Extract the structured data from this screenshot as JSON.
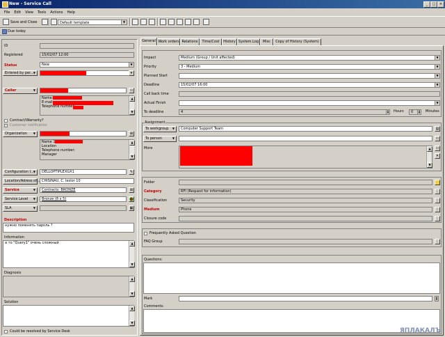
{
  "window": {
    "title": "New - Service Call"
  },
  "menu": [
    "File",
    "Edit",
    "View",
    "Tools",
    "Actions",
    "Help"
  ],
  "toolbar": {
    "save_close": "Save and Close",
    "template": "Default template"
  },
  "due_today": "Due today",
  "left": {
    "id_label": "ID",
    "registered_label": "Registered",
    "registered_value": "15/02/07 12:00",
    "status_label": "Status",
    "status_value": "New",
    "entered_by_label": "Entered by per...",
    "caller_label": "Caller",
    "caller_details": [
      "Name:",
      "E-mail:",
      "Telephone number:"
    ],
    "contract_warranty": "Contract/Warranty?",
    "customer_notification": "Customer notification",
    "organization_label": "Organization",
    "org_details": [
      "Name 1:",
      "Location",
      "Telephone number:",
      "Manager"
    ],
    "config_label": "Configuration I...",
    "config_value": "DELLOPTIPLEXGX1",
    "location_label": "Location/Adress of...",
    "location_value": "CHISINAU, C. Ieslor 10",
    "service_label": "Service",
    "service_value": "Contracts: BRONZE",
    "service_level_label": "Service Level",
    "service_level_value": "Bronze (8 x 5)",
    "sla_label": "SLA",
    "description_label": "Description",
    "description_value": "нужно поменять пароль ?",
    "information_label": "Information",
    "information_value": "а то \"Query1\" очень сложный",
    "diagnosis_label": "Diagnosis",
    "solution_label": "Solution",
    "resolved_label": "Could be resolved by Service Desk"
  },
  "tabs": [
    "General",
    "Work orders",
    "Relations",
    "Time/Cost",
    "History",
    "System.Log",
    "Misc",
    "Copy of History (System)"
  ],
  "general": {
    "impact_label": "Impact",
    "impact_value": "Medium (Group / Unit affected)",
    "priority_label": "Priority",
    "priority_value": "3 - Medium",
    "planned_start_label": "Planned Start",
    "deadline_label": "Deadline",
    "deadline_value": "15/02/07 16:00",
    "call_back_label": "Call back time",
    "actual_finish_label": "Actual Finish",
    "to_deadline_label": "To deadline",
    "to_deadline_value": "4",
    "hours_label": "Hours",
    "minutes_value": "0",
    "minutes_label": "Minutes",
    "assignment_label": "Assignment",
    "to_workgroup_label": "To workgroup",
    "workgroup_value": "Computer Support Team",
    "to_person_label": "To person",
    "more_label": "More",
    "folder_label": "Folder",
    "category_label": "Category",
    "category_value": "RFI (Request for information)",
    "classification_label": "Classification",
    "classification_value": "Security",
    "medium_label": "Medium",
    "medium_value": "Phone",
    "closure_label": "Closure code",
    "faq_label": "Frequently Asked Question",
    "faq_group_label": "FAQ Group",
    "questions_label": "Questions:",
    "mark_label": "Mark",
    "comments_label": "Comments:"
  },
  "watermark": "ЯПЛАКАЛЪ"
}
